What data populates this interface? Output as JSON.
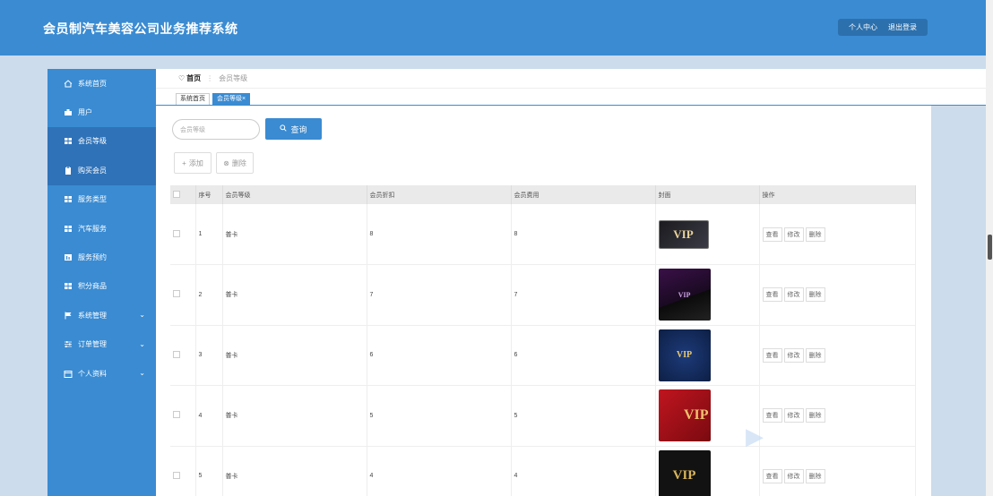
{
  "app": {
    "title": "会员制汽车美容公司业务推荐系统",
    "colors": {
      "primary": "#3a8bd2",
      "page_bg": "#ccdcec"
    }
  },
  "header": {
    "profile_label": "个人中心",
    "logout_label": "退出登录"
  },
  "sidebar": {
    "items": [
      {
        "label": "系统首页",
        "icon": "home-icon"
      },
      {
        "label": "用户",
        "icon": "user-icon"
      },
      {
        "label": "会员等级",
        "icon": "grid-icon"
      },
      {
        "label": "购买会员",
        "icon": "clipboard-icon"
      },
      {
        "label": "服务类型",
        "icon": "grid-icon"
      },
      {
        "label": "汽车服务",
        "icon": "grid-icon"
      },
      {
        "label": "服务预约",
        "icon": "chart-icon"
      },
      {
        "label": "积分商品",
        "icon": "grid-icon"
      },
      {
        "label": "系统管理",
        "icon": "flag-icon"
      },
      {
        "label": "订单管理",
        "icon": "sliders-icon"
      },
      {
        "label": "个人资料",
        "icon": "calendar-icon"
      }
    ]
  },
  "breadcrumb": {
    "home": "首页",
    "current": "会员等级"
  },
  "tabs": [
    {
      "label": "系统首页"
    },
    {
      "label": "会员等级×"
    }
  ],
  "search": {
    "placeholder": "会员等级",
    "button_label": "查询"
  },
  "actions": {
    "add_label": "添加",
    "delete_label": "删除"
  },
  "table": {
    "columns": [
      "序号",
      "会员等级",
      "会员折扣",
      "会员费用",
      "封面",
      "操作"
    ],
    "rows": [
      {
        "index": "1",
        "level": "普卡",
        "discount": "8",
        "fee": "8",
        "cover_text": "VIP"
      },
      {
        "index": "2",
        "level": "普卡",
        "discount": "7",
        "fee": "7",
        "cover_text": "VIP"
      },
      {
        "index": "3",
        "level": "普卡",
        "discount": "6",
        "fee": "6",
        "cover_text": "VIP"
      },
      {
        "index": "4",
        "level": "普卡",
        "discount": "5",
        "fee": "5",
        "cover_text": "VIP"
      },
      {
        "index": "5",
        "level": "普卡",
        "discount": "4",
        "fee": "4",
        "cover_text": "VIP"
      }
    ],
    "row_actions": {
      "view": "查看",
      "edit": "修改",
      "delete": "删除"
    }
  }
}
